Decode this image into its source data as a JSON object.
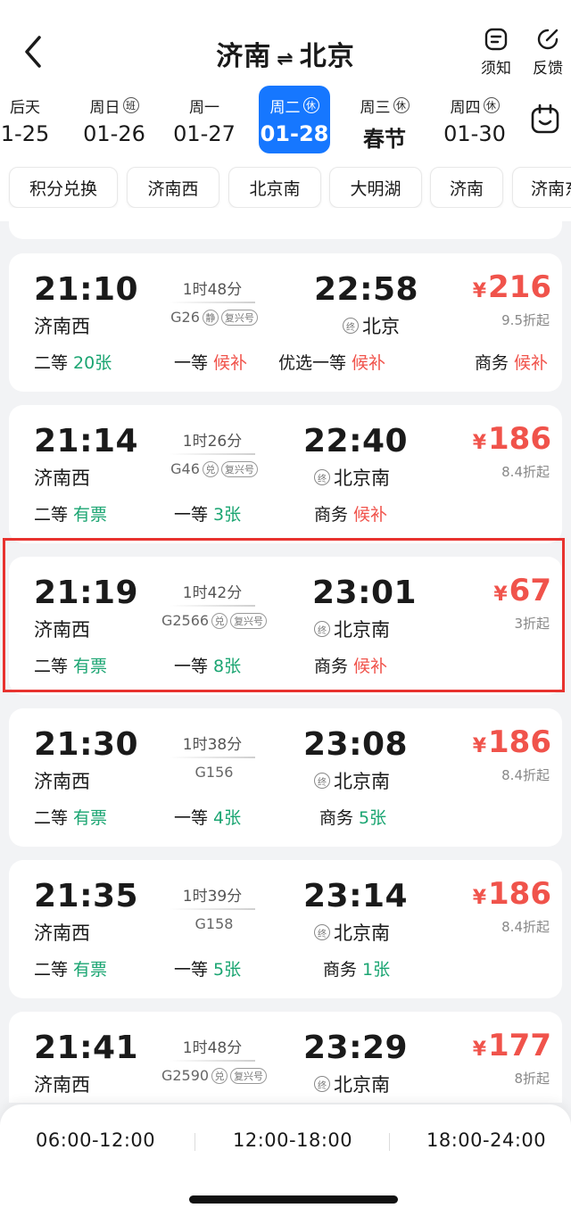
{
  "header": {
    "from": "济南",
    "swap_icon": "⇌",
    "to": "北京",
    "notice_label": "须知",
    "feedback_label": "反馈"
  },
  "dates": [
    {
      "weekday": "后天",
      "tag": "",
      "date": "1-25",
      "active": false
    },
    {
      "weekday": "周日",
      "tag": "班",
      "date": "01-26",
      "active": false
    },
    {
      "weekday": "周一",
      "tag": "",
      "date": "01-27",
      "active": false
    },
    {
      "weekday": "周二",
      "tag": "休",
      "date": "01-28",
      "active": true
    },
    {
      "weekday": "周三",
      "tag": "休",
      "date": "春节",
      "active": false
    },
    {
      "weekday": "周四",
      "tag": "休",
      "date": "01-30",
      "active": false
    }
  ],
  "filters": [
    "积分兑换",
    "济南西",
    "北京南",
    "大明湖",
    "济南",
    "济南东"
  ],
  "trains": [
    {
      "dep_time": "21:10",
      "dep_station": "济南西",
      "duration": "1时48分",
      "train_no": "G26",
      "badges": [
        "静",
        "复兴号"
      ],
      "arr_time": "22:58",
      "terminal": "终",
      "arr_station": "北京",
      "price": "216",
      "currency": "¥",
      "discount": "9.5折起",
      "seats": [
        {
          "class": "二等",
          "status": "20张",
          "color": "green"
        },
        {
          "class": "一等",
          "status": "候补",
          "color": "red"
        },
        {
          "class": "优选一等",
          "status": "候补",
          "color": "red"
        },
        {
          "class": "商务",
          "status": "候补",
          "color": "red"
        }
      ]
    },
    {
      "dep_time": "21:14",
      "dep_station": "济南西",
      "duration": "1时26分",
      "train_no": "G46",
      "badges": [
        "兑",
        "复兴号"
      ],
      "arr_time": "22:40",
      "terminal": "终",
      "arr_station": "北京南",
      "price": "186",
      "currency": "¥",
      "discount": "8.4折起",
      "seats": [
        {
          "class": "二等",
          "status": "有票",
          "color": "green"
        },
        {
          "class": "一等",
          "status": "3张",
          "color": "green"
        },
        {
          "class": "商务",
          "status": "候补",
          "color": "red"
        }
      ]
    },
    {
      "dep_time": "21:19",
      "dep_station": "济南西",
      "duration": "1时42分",
      "train_no": "G2566",
      "badges": [
        "兑",
        "复兴号"
      ],
      "arr_time": "23:01",
      "terminal": "终",
      "arr_station": "北京南",
      "price": "67",
      "currency": "¥",
      "discount": "3折起",
      "seats": [
        {
          "class": "二等",
          "status": "有票",
          "color": "green"
        },
        {
          "class": "一等",
          "status": "8张",
          "color": "green"
        },
        {
          "class": "商务",
          "status": "候补",
          "color": "red"
        }
      ]
    },
    {
      "dep_time": "21:30",
      "dep_station": "济南西",
      "duration": "1时38分",
      "train_no": "G156",
      "badges": [],
      "arr_time": "23:08",
      "terminal": "终",
      "arr_station": "北京南",
      "price": "186",
      "currency": "¥",
      "discount": "8.4折起",
      "seats": [
        {
          "class": "二等",
          "status": "有票",
          "color": "green"
        },
        {
          "class": "一等",
          "status": "4张",
          "color": "green"
        },
        {
          "class": "商务",
          "status": "5张",
          "color": "green"
        }
      ]
    },
    {
      "dep_time": "21:35",
      "dep_station": "济南西",
      "duration": "1时39分",
      "train_no": "G158",
      "badges": [],
      "arr_time": "23:14",
      "terminal": "终",
      "arr_station": "北京南",
      "price": "186",
      "currency": "¥",
      "discount": "8.4折起",
      "seats": [
        {
          "class": "二等",
          "status": "有票",
          "color": "green"
        },
        {
          "class": "一等",
          "status": "5张",
          "color": "green"
        },
        {
          "class": "商务",
          "status": "1张",
          "color": "green"
        }
      ]
    },
    {
      "dep_time": "21:41",
      "dep_station": "济南西",
      "duration": "1时48分",
      "train_no": "G2590",
      "badges": [
        "兑",
        "复兴号"
      ],
      "arr_time": "23:29",
      "terminal": "终",
      "arr_station": "北京南",
      "price": "177",
      "currency": "¥",
      "discount": "8折起",
      "seats": []
    }
  ],
  "time_slots": [
    "06:00-12:00",
    "12:00-18:00",
    "18:00-24:00"
  ],
  "colors": {
    "accent": "#1677ff",
    "price": "#f0534b",
    "available": "#1ba572",
    "highlight_border": "#e8332f"
  }
}
